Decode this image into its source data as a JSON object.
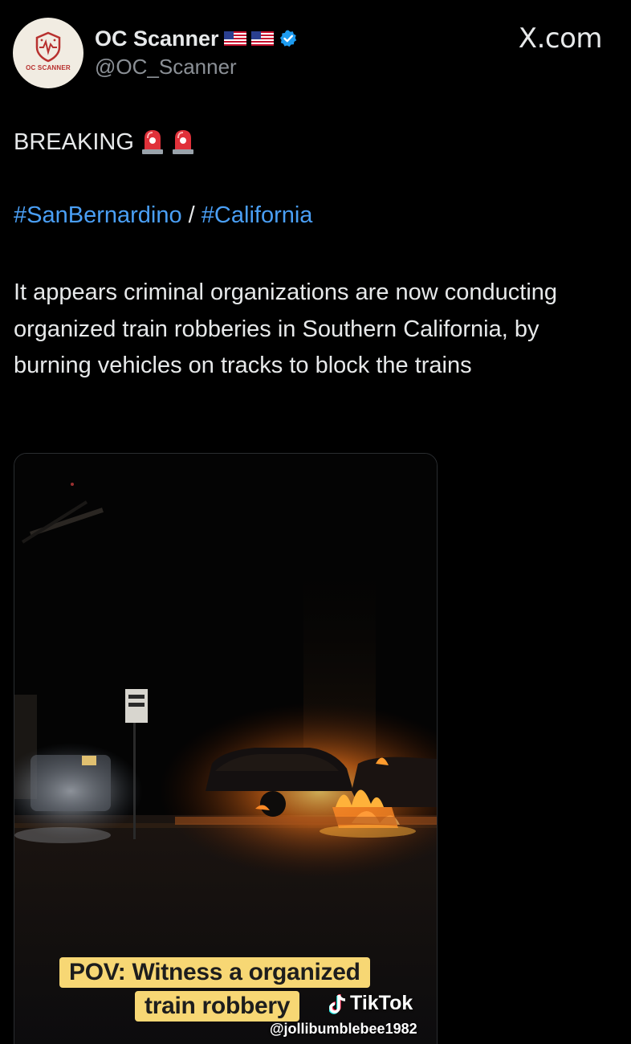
{
  "post": {
    "author": {
      "display_name": "OC Scanner",
      "handle": "@OC_Scanner",
      "verified": true,
      "flags": [
        "us-flag-icon",
        "us-flag-icon"
      ],
      "avatar": {
        "logo_text": "OC SCANNER",
        "colors": {
          "accent": "#b8312f",
          "background": "#f1ece2"
        }
      }
    },
    "brand": "X.com",
    "headline": "BREAKING",
    "headline_icons": [
      "siren-icon",
      "siren-icon"
    ],
    "hashtags": [
      "#SanBernardino",
      "#California"
    ],
    "hashtag_separator": "/",
    "text": "It appears criminal organizations are now conducting organized train robberies in Southern California, by burning vehicles on tracks to block the trains",
    "media": {
      "caption_line1": "POV: Witness a organized",
      "caption_line2": "train robbery",
      "tiktok_label": "TikTok",
      "tiktok_user": "@jollibumblebee1982"
    }
  },
  "colors": {
    "background": "#000000",
    "text": "#e7e9ea",
    "secondary_text": "#8b9096",
    "link": "#4a9ff5",
    "verified": "#1d9bf0",
    "caption_bg": "#f7d774"
  }
}
